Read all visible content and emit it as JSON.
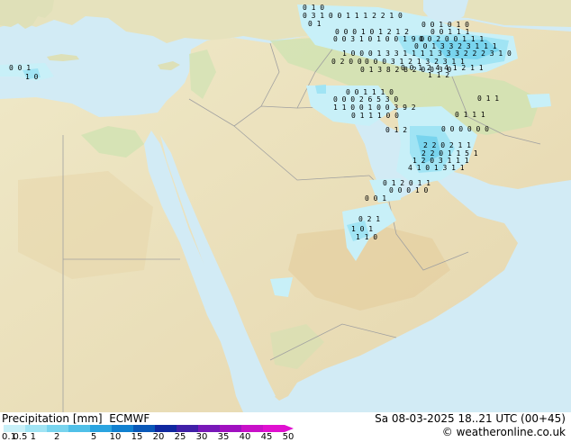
{
  "legend": {
    "title": "Precipitation [mm]",
    "model": "ECMWF",
    "ticks": [
      "0.1",
      "0.5",
      "1",
      "2",
      "5",
      "10",
      "15",
      "20",
      "25",
      "30",
      "35",
      "40",
      "45",
      "50"
    ],
    "colors": [
      "#c8f0f8",
      "#a0e4f4",
      "#78d4ee",
      "#50c0e8",
      "#2aa4e0",
      "#1080d0",
      "#0a58b8",
      "#1028a0",
      "#4020a8",
      "#7818b8",
      "#a010c0",
      "#c810c8",
      "#e010d0"
    ]
  },
  "valid_time": "Sa 08-03-2025 18..21 UTC (00+45)",
  "credit": "© weatheronline.co.uk",
  "colors": {
    "sea": "#d2ebf5",
    "land": "#efe9c5",
    "land_green": "#cfe2b2",
    "desert": "#e8d9b0",
    "border": "#a0a0a0"
  },
  "station_values": [
    "0 1 0",
    "0 3 1 0 0 1 1 1 2 2 1 0",
    "0 1",
    "0 0 0 1 0 1 2 1 2",
    "0 0 3 1 0 1 0 0 1 9 0",
    "0 0 1 0 1 0",
    "1 0 0 0 1 3 3 1 1 1 1 3 3 3 2 2 2 3 1 0",
    "0 2 0 0",
    "0 0 0 3 1 2 1 3 2 3 1 1",
    "0 0 1 1 1 0",
    "0 0 0 2 6 5 3 0",
    "1 1 0 0 1 0 0 3 9 2",
    "0 1 1 1 0 0",
    "0 1 2",
    "2 2 0 2 1 1",
    "2 2 0 1 1 5 1",
    "1 2 0 3 1 1 1",
    "4 1 0 1 3 1 1",
    "0 1 2 0 1 1",
    "0 0 0 1 0",
    "0 2 1",
    "1 0 1",
    "1 1 0",
    "0 0 1",
    "0 0 1 1 1",
    "0 0 2 0 0 1 1 1",
    "0 0 1 3 3 2 3 1 1 1",
    "1 1 2",
    "0 0 1 2 4 4 1 2 1 1",
    "0 1 3 8 2 8 2 0 0 3 0",
    "0 0 1",
    "1 0",
    "0 1 1",
    "0 1 1 1",
    "0 0 0 0 0 0"
  ]
}
